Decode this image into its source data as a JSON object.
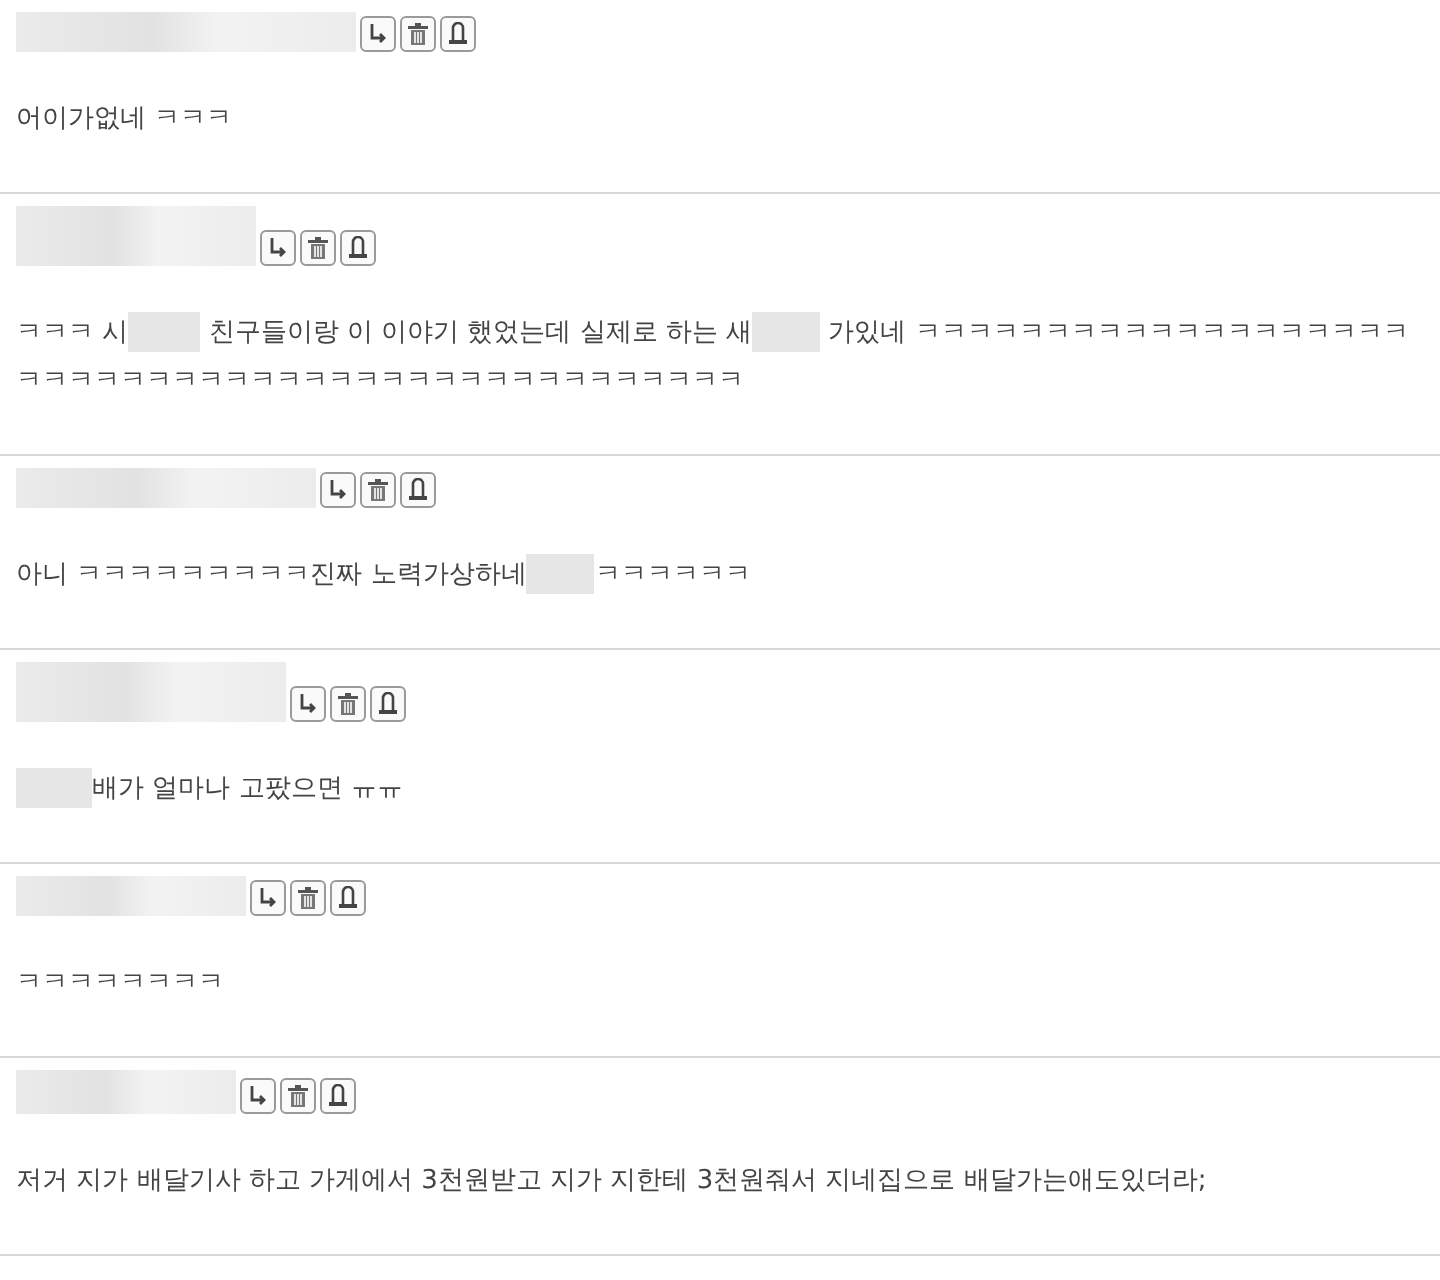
{
  "comments": [
    {
      "lines": [
        [
          {
            "kind": "text",
            "text": "어이가없네 ㅋㅋㅋ"
          }
        ]
      ]
    },
    {
      "lines": [
        [
          {
            "kind": "text",
            "text": "ㅋㅋㅋ 시"
          },
          {
            "kind": "blur"
          },
          {
            "kind": "text",
            "text": " 친구들이랑 이 이야기 했었는데 실제로 하는 새"
          },
          {
            "kind": "blur"
          },
          {
            "kind": "text",
            "text": " 가있네 ㅋㅋㅋㅋㅋㅋㅋㅋㅋㅋㅋㅋㅋㅋㅋㅋㅋㅋㅋ"
          }
        ],
        [
          {
            "kind": "text",
            "text": "ㅋㅋㅋㅋㅋㅋㅋㅋㅋㅋㅋㅋㅋㅋㅋㅋㅋㅋㅋㅋㅋㅋㅋㅋㅋㅋㅋㅋ"
          }
        ]
      ]
    },
    {
      "lines": [
        [
          {
            "kind": "text",
            "text": "아니 ㅋㅋㅋㅋㅋㅋㅋㅋㅋ진짜 노력가상하네"
          },
          {
            "kind": "blur"
          },
          {
            "kind": "text",
            "text": "ㅋㅋㅋㅋㅋㅋ"
          }
        ]
      ]
    },
    {
      "lines": [
        [
          {
            "kind": "blur"
          },
          {
            "kind": "text",
            "text": "배가 얼마나 고팠으면 ㅠㅠ"
          }
        ]
      ]
    },
    {
      "lines": [
        [
          {
            "kind": "text",
            "text": "ㅋㅋㅋㅋㅋㅋㅋㅋ"
          }
        ]
      ]
    },
    {
      "lines": [
        [
          {
            "kind": "text",
            "text": "저거 지가 배달기사 하고 가게에서 3천원받고 지가 지한테 3천원줘서 지네집으로 배달가는애도있더라;"
          }
        ]
      ]
    }
  ]
}
